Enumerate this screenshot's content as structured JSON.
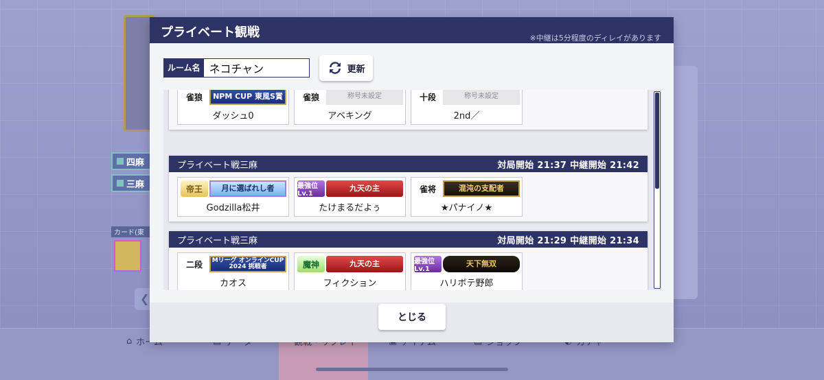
{
  "background": {
    "chip_four": "四麻",
    "chip_three": "三麻",
    "card_label": "カード(東",
    "nav": [
      {
        "label": "ホーム"
      },
      {
        "label": "データ"
      },
      {
        "label": "観戦・リプレイ"
      },
      {
        "label": "アイテム"
      },
      {
        "label": "ショップ"
      },
      {
        "label": "ガチャ"
      }
    ]
  },
  "modal": {
    "title": "プライベート観戦",
    "note": "※中継は5分程度のディレイがあります",
    "room_label": "ルーム名",
    "room_value": "ネコチャン",
    "refresh_label": "更新",
    "close_label": "とじる"
  },
  "rooms": [
    {
      "partial": true,
      "players": [
        {
          "rank": "雀狼",
          "title": "NPM CUP 東風S賞",
          "name": "ダッシュ0"
        },
        {
          "rank": "雀狼",
          "title": "称号未設定",
          "name": "アベキング"
        },
        {
          "rank": "十段",
          "title": "称号未設定",
          "name": "2nd／"
        }
      ]
    },
    {
      "type": "プライベート戦三麻",
      "times": "対局開始  21:37   中継開始  21:42",
      "players": [
        {
          "rank": "帝王",
          "title": "月に選ばれし者",
          "name": "Godzilla松井"
        },
        {
          "rank": "最強位Lv.1",
          "title": "九天の主",
          "name": "たけまるだよぅ"
        },
        {
          "rank": "雀将",
          "title": "混沌の支配者",
          "name": "★パナイノ★"
        }
      ]
    },
    {
      "type": "プライベート戦三麻",
      "times": "対局開始  21:29   中継開始  21:34",
      "players": [
        {
          "rank": "二段",
          "title": "Mリーグ オンラインCUP 2024 挑戦者",
          "name": "カオス"
        },
        {
          "rank": "魔神",
          "title": "九天の主",
          "name": "フィクション"
        },
        {
          "rank": "最強位Lv.1",
          "title": "天下無双",
          "name": "ハリボテ野郎"
        }
      ]
    }
  ],
  "colors": {
    "navy": "#2e3366",
    "panel": "#f3f4f8"
  }
}
